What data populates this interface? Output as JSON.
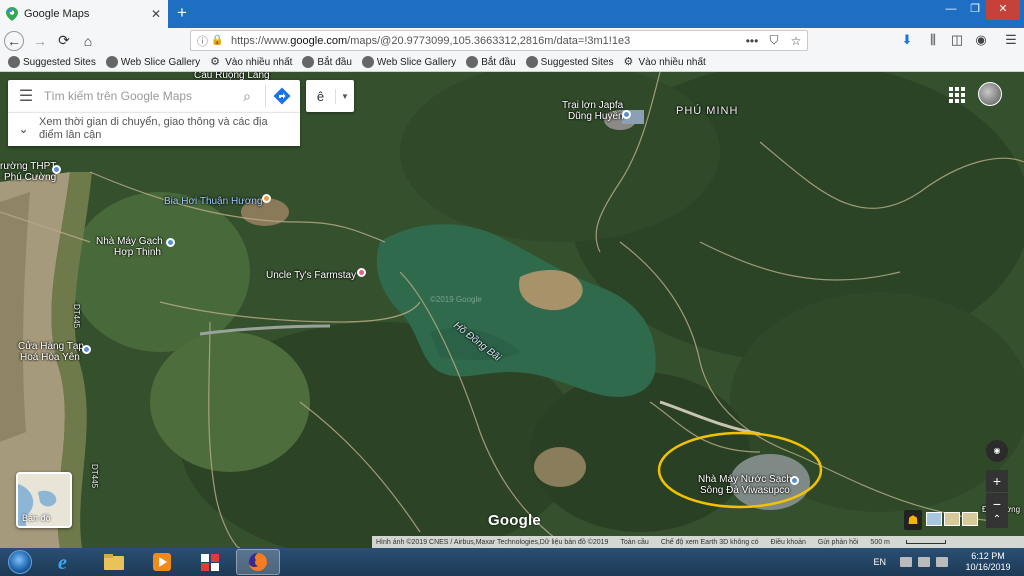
{
  "browser": {
    "tab_title": "Google Maps",
    "url_prefix": "https://www.",
    "url_domain": "google.com",
    "url_rest": "/maps/@20.9773099,105.3663312,2816m/data=!3m1!1e3",
    "icons": {
      "back": "back-arrow-icon",
      "forward": "forward-arrow-icon",
      "reload": "reload-icon",
      "home": "home-icon",
      "lock": "lock-icon",
      "page_actions": "more-icon",
      "pocket": "pocket-icon",
      "bookmark": "star-icon",
      "download": "download-icon",
      "library": "library-icon",
      "sidebar": "sidebar-icon",
      "account": "account-icon",
      "menu": "hamburger-menu-icon"
    }
  },
  "bookmarks": [
    {
      "label": "Suggested Sites",
      "icon": "globe-icon"
    },
    {
      "label": "Web Slice Gallery",
      "icon": "globe-icon"
    },
    {
      "label": "Vào nhiều nhất",
      "icon": "gear-icon"
    },
    {
      "label": "Bắt đầu",
      "icon": "globe-icon"
    },
    {
      "label": "Web Slice Gallery",
      "icon": "globe-icon"
    },
    {
      "label": "Bắt đầu",
      "icon": "globe-icon"
    },
    {
      "label": "Suggested Sites",
      "icon": "globe-icon"
    },
    {
      "label": "Vào nhiều nhất",
      "icon": "gear-icon"
    }
  ],
  "maps": {
    "search_placeholder": "Tìm kiếm trên Google Maps",
    "suggestion": "Xem thời gian di chuyển, giao thông và các địa điểm lân cận",
    "lang_value": "ê",
    "layer_label": "Bản đồ",
    "logo": "Google",
    "labels": {
      "cau_ruong_lang": "Cầu Ruộng Láng",
      "trai_lon": "Trại lợn Japfa",
      "dung_huyen": "Dũng Huyền",
      "phu_minh": "PHÚ MINH",
      "thpt1": "rường THPT",
      "thpt2": "Phú Cường",
      "bia_hoi": "Bia Hơi Thuận Hương",
      "gach1": "Nhà Máy Gạch",
      "gach2": "Hợp Thịnh",
      "farmstay": "Uncle Ty's Farmstay",
      "ho_dong_bai": "Hồ Đồng Bãi",
      "watermark": "©2019 Google",
      "road_dt445": "DT445",
      "road_dt445b": "DT445",
      "cuahang1": "Cửa Hàng Tạp",
      "cuahang2": "Hoá Hòa Yên",
      "nuoc1": "Nhà Máy Nước Sạch",
      "nuoc2": "Sông Đà Viwasupco",
      "dt_duong": "ĐT Đường"
    },
    "attribution": {
      "imagery": "Hình ảnh ©2019 CNES / Airbus,Maxar Technologies,Dữ liệu bản đồ ©2019",
      "global": "Toàn cầu",
      "earth": "Chế độ xem Earth 3D không có",
      "terms": "Điều khoản",
      "feedback": "Gửi phản hồi",
      "scale": "500 m"
    },
    "highlight_color": "#f2c200"
  },
  "taskbar": {
    "lang": "EN",
    "time": "6:12 PM",
    "date": "10/16/2019",
    "apps": [
      "windows-media-icon",
      "internet-explorer-icon",
      "file-explorer-icon",
      "media-player-icon",
      "app-icon",
      "firefox-icon"
    ]
  }
}
